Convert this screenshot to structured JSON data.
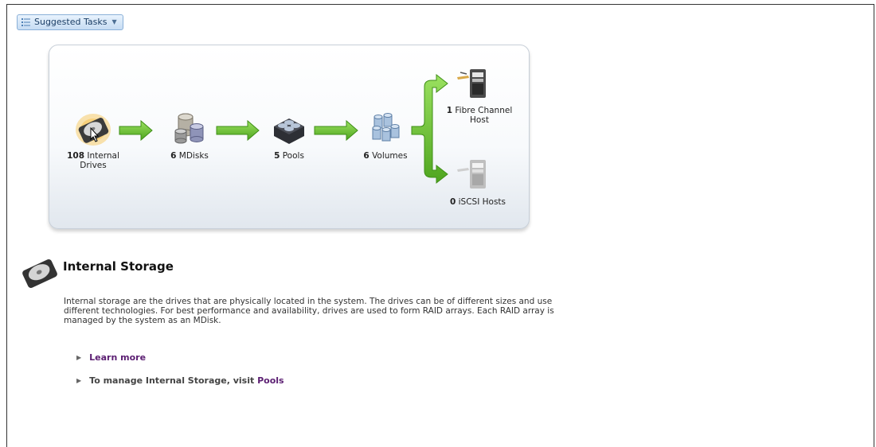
{
  "toolbar": {
    "suggested_tasks_label": "Suggested Tasks"
  },
  "flow": {
    "drives": {
      "count": "108",
      "label": "Internal",
      "label2": "Drives"
    },
    "mdisks": {
      "count": "6",
      "label": "MDisks"
    },
    "pools": {
      "count": "5",
      "label": "Pools"
    },
    "volumes": {
      "count": "6",
      "label": "Volumes"
    },
    "fc_hosts": {
      "count": "1",
      "label": "Fibre Channel",
      "label2": "Host"
    },
    "iscsi_hosts": {
      "count": "0",
      "label": "iSCSI Hosts"
    }
  },
  "section": {
    "title": "Internal Storage",
    "description": "Internal storage are the drives that are physically located in the system. The drives can be of different sizes and use different technologies. For best performance and availability, drives are used to form RAID arrays. Each RAID array is managed by the system as an MDisk.",
    "learn_more": "Learn more",
    "manage_prefix": "To manage Internal Storage, visit",
    "manage_link": "Pools"
  },
  "colors": {
    "arrow_green": "#6cc23a",
    "link_purple": "#5b1e72",
    "highlight": "#f7c04a"
  },
  "icons": [
    "list-icon",
    "caret-down-icon",
    "hard-drive-icon",
    "mdisks-icon",
    "pools-icon",
    "volumes-icon",
    "fc-host-icon",
    "iscsi-host-icon",
    "arrow-right-icon",
    "triangle-right-icon"
  ]
}
